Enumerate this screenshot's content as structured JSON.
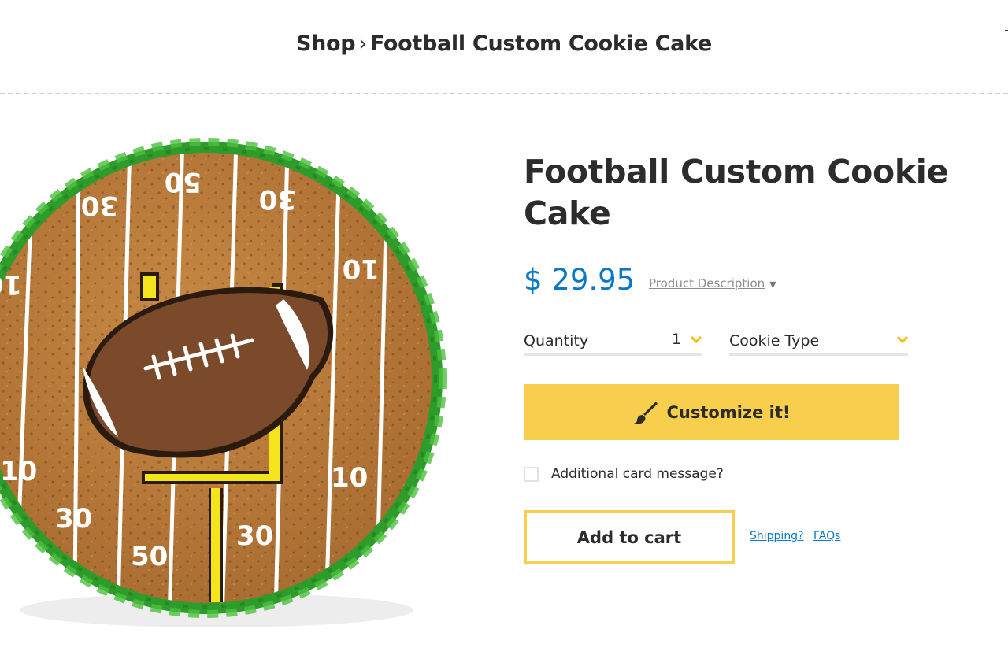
{
  "breadcrumb": {
    "shop": "Shop",
    "separator": "›",
    "current": "Football Custom Cookie Cake"
  },
  "product": {
    "title": "Football Custom Cookie Cake",
    "price": "$ 29.95",
    "description_link": "Product Description",
    "image": {
      "icon": "football-cookie-cake-image",
      "yard_labels": [
        "30",
        "50",
        "30",
        "10",
        "10",
        "30",
        "50",
        "30",
        "10",
        "10"
      ]
    }
  },
  "options": {
    "quantity_label": "Quantity",
    "quantity_value": "1",
    "cookie_type_label": "Cookie Type",
    "cookie_type_value": ""
  },
  "actions": {
    "customize_label": "Customize it!",
    "card_message_label": "Additional card message?",
    "card_message_checked": false,
    "add_to_cart_label": "Add to cart"
  },
  "links": {
    "shipping": "Shipping?",
    "faqs": "FAQs"
  },
  "colors": {
    "accent_yellow": "#f8cf4c",
    "price_blue": "#0a78c8",
    "icing_green": "#2e9c2a",
    "cookie_brown": "#b77a3b",
    "football_brown": "#7a4a2a"
  }
}
